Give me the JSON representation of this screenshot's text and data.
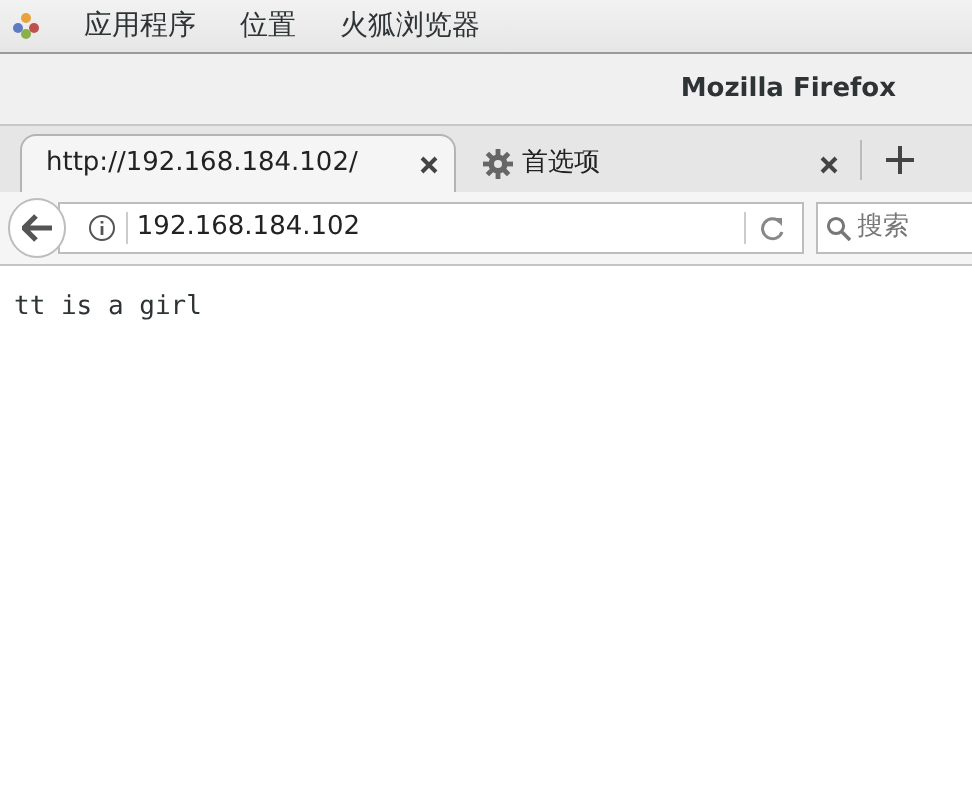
{
  "top_bar": {
    "menus": [
      "应用程序",
      "位置",
      "火狐浏览器"
    ]
  },
  "window": {
    "title": "Mozilla Firefox"
  },
  "tabs": [
    {
      "label": "http://192.168.184.102/",
      "selected": true,
      "kind": "page"
    },
    {
      "label": "首选项",
      "selected": false,
      "kind": "settings"
    }
  ],
  "address_bar": {
    "value": "192.168.184.102"
  },
  "search": {
    "placeholder": "搜索"
  },
  "page": {
    "text": "tt is a girl"
  }
}
